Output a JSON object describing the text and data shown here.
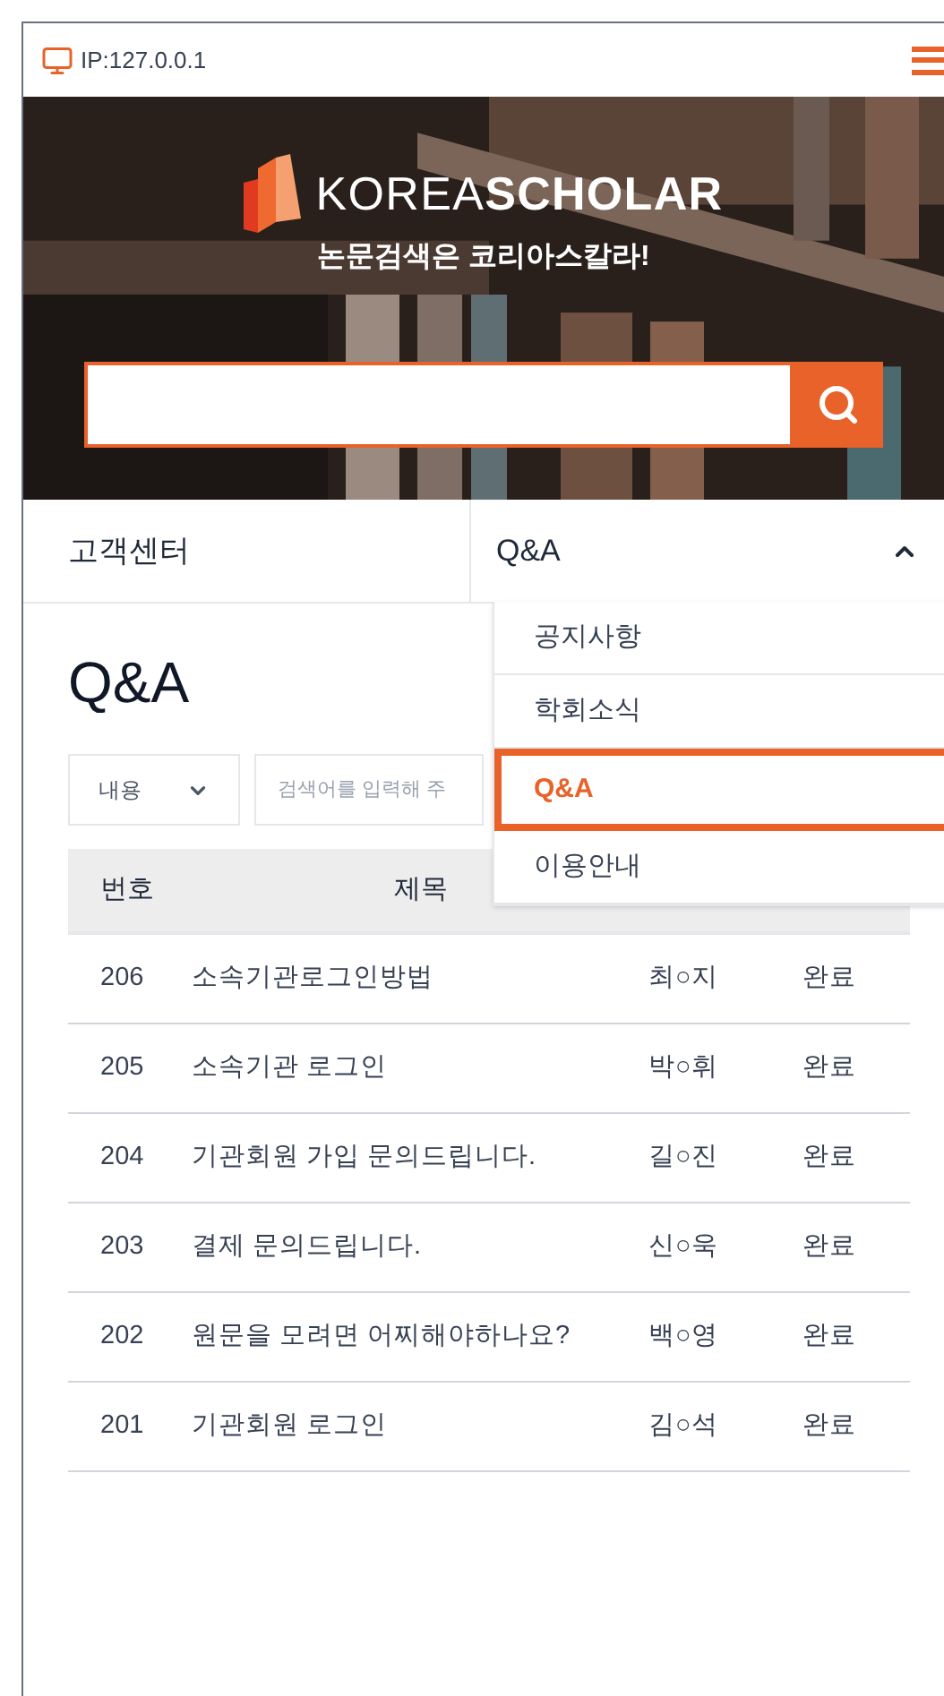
{
  "header": {
    "ip": "IP:127.0.0.1"
  },
  "hero": {
    "kind": "picture",
    "logo_light": "KOREA",
    "logo_bold": "SCHOLAR",
    "tagline": "논문검색은 코리아스칼라!"
  },
  "nav": {
    "section": "고객센터",
    "current": "Q&A",
    "expanded": true,
    "menu": [
      {
        "label": "공지사항",
        "selected": false
      },
      {
        "label": "학회소식",
        "selected": false
      },
      {
        "label": "Q&A",
        "selected": true
      },
      {
        "label": "이용안내",
        "selected": false
      }
    ]
  },
  "page_title": "Q&A",
  "filter": {
    "select": "내용",
    "placeholder": "검색어를 입력해 주"
  },
  "table": {
    "columns": [
      "번호",
      "제목"
    ],
    "rows": [
      {
        "no": "206",
        "title": "소속기관로그인방법",
        "author": "최○지",
        "status": "완료"
      },
      {
        "no": "205",
        "title": "소속기관 로그인",
        "author": "박○휘",
        "status": "완료"
      },
      {
        "no": "204",
        "title": "기관회원 가입 문의드립니다.",
        "author": "길○진",
        "status": "완료"
      },
      {
        "no": "203",
        "title": "결제 문의드립니다.",
        "author": "신○욱",
        "status": "완료"
      },
      {
        "no": "202",
        "title": "원문을 모려면 어찌해야하나요?",
        "author": "백○영",
        "status": "완료"
      },
      {
        "no": "201",
        "title": "기관회원 로그인",
        "author": "김○석",
        "status": "완료"
      }
    ]
  }
}
